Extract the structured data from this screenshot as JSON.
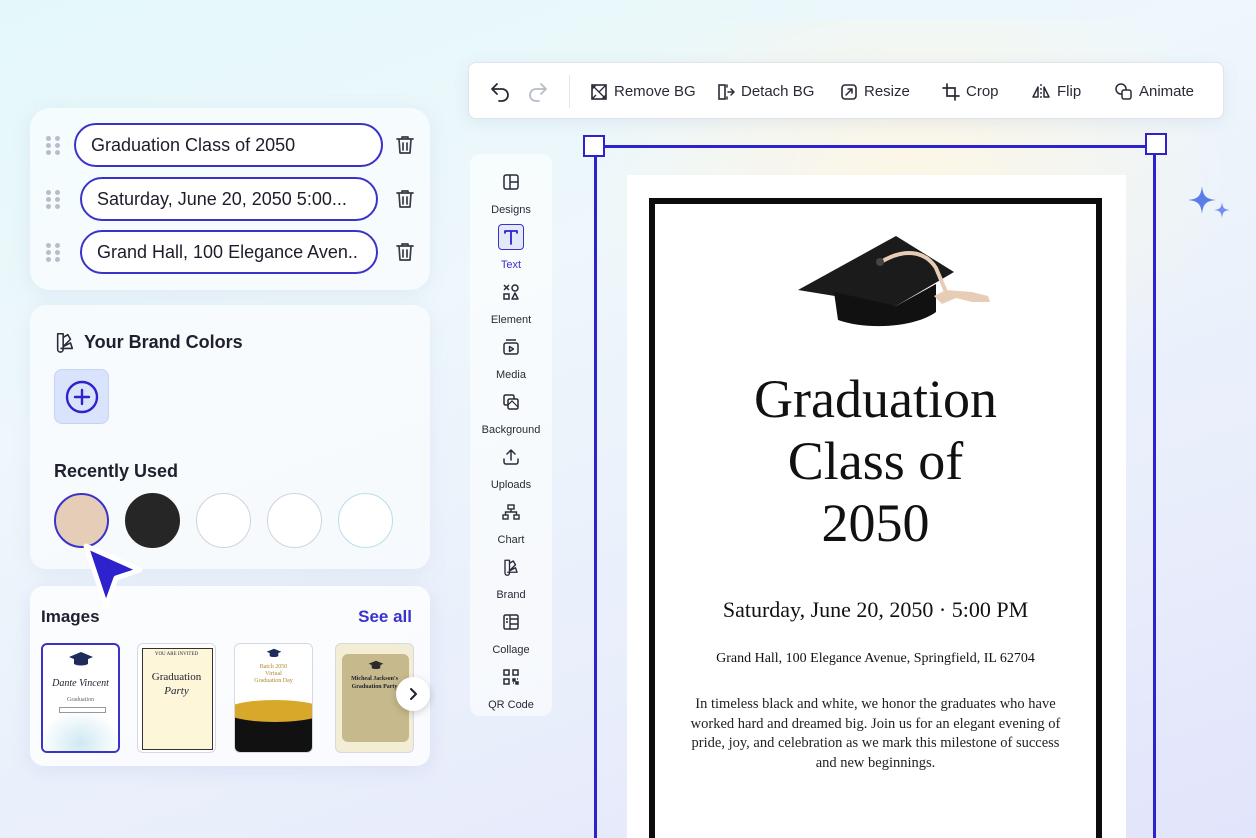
{
  "text_layers": [
    {
      "value": "Graduation Class of 2050"
    },
    {
      "value": "Saturday, June 20, 2050 5:00..."
    },
    {
      "value": "Grand Hall, 100 Elegance Aven.."
    }
  ],
  "brand": {
    "title": "Your Brand Colors",
    "recent_title": "Recently Used",
    "recent_colors": [
      "#e6cdb8",
      "#262626",
      "#ffffff",
      "#ffffff",
      "#ffffff"
    ]
  },
  "images": {
    "title": "Images",
    "see_all": "See all",
    "thumbs": [
      {
        "line1": "Dante Vincent",
        "line2": "Graduation"
      },
      {
        "line1": "YOU ARE INVITED",
        "line2": "Graduation",
        "line3": "Party"
      },
      {
        "line1": "Batch 2050",
        "line2": "Virtual",
        "line3": "Graduation Day"
      },
      {
        "line1": "Micheal Jackson's",
        "line2": "Graduation Party"
      }
    ]
  },
  "toolbar": {
    "remove_bg": "Remove BG",
    "detach_bg": "Detach BG",
    "resize": "Resize",
    "crop": "Crop",
    "flip": "Flip",
    "animate": "Animate"
  },
  "sidemenu": [
    {
      "label": "Designs",
      "icon": "layout-icon"
    },
    {
      "label": "Text",
      "icon": "text-icon"
    },
    {
      "label": "Element",
      "icon": "shapes-icon"
    },
    {
      "label": "Media",
      "icon": "media-icon"
    },
    {
      "label": "Background",
      "icon": "background-icon"
    },
    {
      "label": "Uploads",
      "icon": "upload-icon"
    },
    {
      "label": "Chart",
      "icon": "chart-icon"
    },
    {
      "label": "Brand",
      "icon": "brand-icon"
    },
    {
      "label": "Collage",
      "icon": "collage-icon"
    },
    {
      "label": "QR Code",
      "icon": "qr-code-icon"
    }
  ],
  "card": {
    "title_line1": "Graduation",
    "title_line2": "Class of",
    "title_line3": "2050",
    "date": "Saturday, June 20, 2050 · 5:00 PM",
    "venue": "Grand Hall, 100 Elegance Avenue, Springfield, IL 62704",
    "body": "In timeless black and white, we honor the graduates who have worked hard and dreamed big. Join us for an elegant evening of pride, joy, and celebration as we mark this milestone of success and new beginnings."
  },
  "colors": {
    "accent": "#3b33c9",
    "selection": "#2e22cc"
  }
}
